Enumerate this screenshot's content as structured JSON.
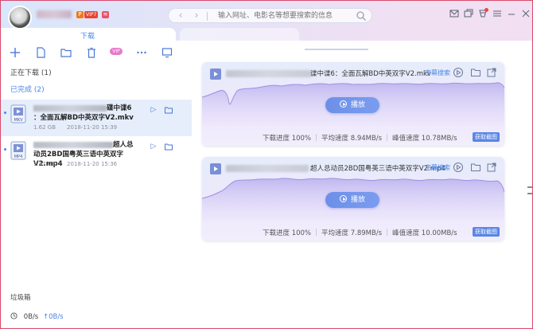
{
  "header": {
    "vip_badge": "VIP7",
    "p_badge": "P",
    "lv_badge": "≋",
    "nav_search_placeholder": "输入网址、电影名等想要搜索的信息",
    "tab_download": "下载",
    "icons": [
      "mail-icon",
      "restore-window-icon",
      "skin-icon",
      "menu-icon",
      "minimize-icon",
      "close-icon"
    ]
  },
  "toolbar": {
    "vip_label": "VIP",
    "icons": [
      "add-icon",
      "new-file-icon",
      "folder-icon",
      "delete-icon",
      "more-icon",
      "screen-icon"
    ]
  },
  "sidebar": {
    "downloading_label": "正在下载 (1)",
    "completed_label": "已完成 (2)",
    "items": [
      {
        "ext": "MKV",
        "name_line1_suffix": "碟中谍6",
        "name_line2": "：全面瓦解BD中英双字V2.mkv",
        "size": "1.62 GB",
        "date": "2018-11-20 15:39"
      },
      {
        "ext": "MP4",
        "name_line1_suffix": "超人总",
        "name_line2": "动员2BD国粤英三语中英双字V2.mp4",
        "size": "1.47 GB",
        "date": "2018-11-20 15:36"
      }
    ],
    "trash_label": "垃圾箱",
    "status_down": "0B/s",
    "status_up": "↑0B/s"
  },
  "cards": [
    {
      "title": "谍中谍6：全面瓦解BD中英双字V2.mkv",
      "subtitle_search": "字幕搜索",
      "play_label": "播放",
      "progress_text": "下载进度 100%",
      "avg_speed_text": "平均速度 8.94MB/s",
      "peak_speed_text": "峰值速度 10.78MB/s",
      "screenshot_label": "获取截图"
    },
    {
      "title": "超人总动员2BD国粤英三语中英双字V2.mp4",
      "subtitle_search": "字幕搜索",
      "play_label": "播放",
      "progress_text": "下载进度 100%",
      "avg_speed_text": "平均速度 7.89MB/s",
      "peak_speed_text": "峰值速度 10.00MB/s",
      "screenshot_label": "获取截图"
    }
  ],
  "colors": {
    "accent": "#4a85e8",
    "selection": "#e6eefb",
    "play": "#7396ee",
    "frame": "#d84a6a"
  }
}
